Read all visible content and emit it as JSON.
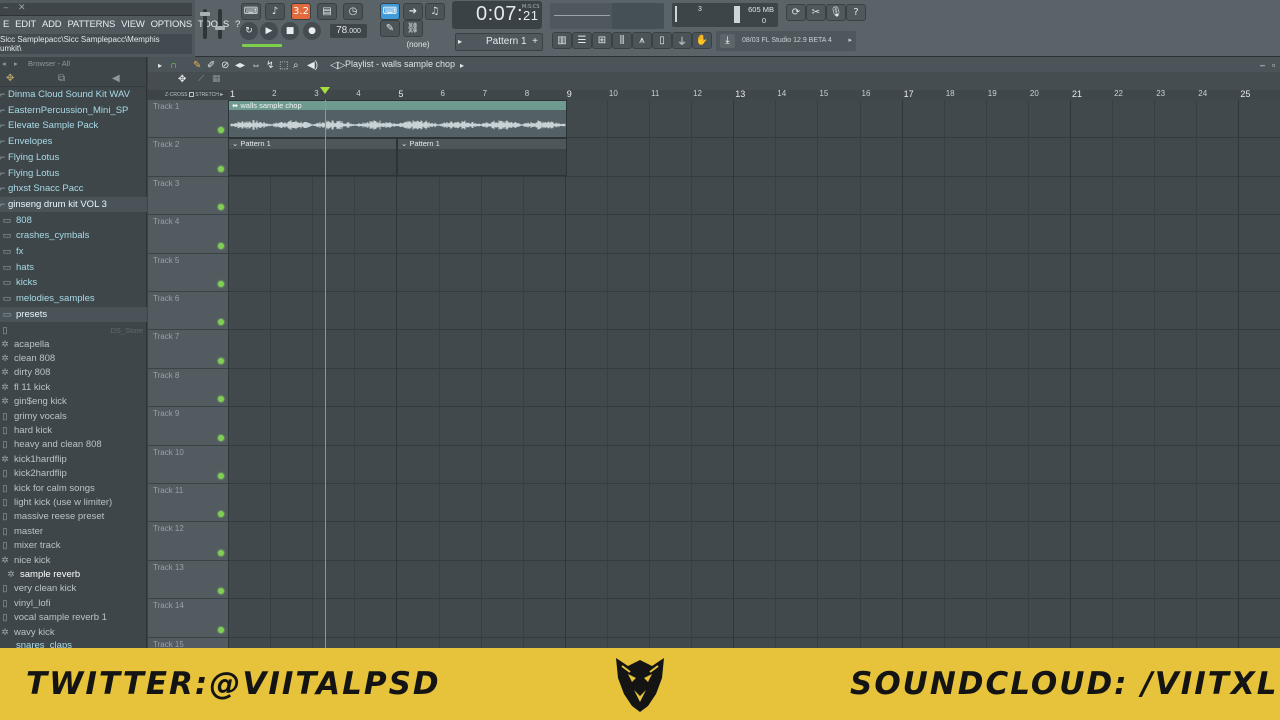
{
  "toolbar": {
    "menu": [
      "E",
      "EDIT",
      "ADD",
      "PATTERNS",
      "VIEW",
      "OPTIONS",
      "TOOLS",
      "?"
    ],
    "project_path": "Sicc Samplepacc\\Sicc Samplepacc\\Memphis\numkit\\",
    "tempo": "78",
    "tempo_decimal": ".000",
    "time": "0:07",
    "time_sub": "21",
    "time_unit": "M:S:CS",
    "pattern": "Pattern 1",
    "none_label": "(none)",
    "memory": "605 MB",
    "cpu_num": "3",
    "cpu_val": "0",
    "news": "08/03  FL Studio 12.9 BETA 4",
    "song_mode_label": "3.2"
  },
  "browser": {
    "header": "Browser - All",
    "items": [
      {
        "label": "Dinma Cloud Sound Kit WAV",
        "kind": "folder"
      },
      {
        "label": "EasternPercussion_Mini_SP",
        "kind": "folder"
      },
      {
        "label": "Elevate Sample Pack",
        "kind": "folder"
      },
      {
        "label": "Envelopes",
        "kind": "folder"
      },
      {
        "label": "Flying Lotus",
        "kind": "folder"
      },
      {
        "label": "Flying Lotus",
        "kind": "folder"
      },
      {
        "label": "ghxst Snacc Pacc",
        "kind": "folder"
      },
      {
        "label": "ginseng drum kit VOL 3",
        "kind": "open"
      },
      {
        "label": "808",
        "kind": "sub"
      },
      {
        "label": "crashes_cymbals",
        "kind": "sub"
      },
      {
        "label": "fx",
        "kind": "sub"
      },
      {
        "label": "hats",
        "kind": "sub"
      },
      {
        "label": "kicks",
        "kind": "sub"
      },
      {
        "label": "melodies_samples",
        "kind": "sub"
      },
      {
        "label": "presets",
        "kind": "sub-open"
      }
    ],
    "ds_store": "DS_Store",
    "presets": [
      "acapella",
      "clean 808",
      "dirty 808",
      "fl 11 kick",
      "gin$eng kick",
      "grimy vocals",
      "hard kick",
      "heavy and clean 808",
      "kick1hardflip",
      "kick2hardflip",
      "kick for calm songs",
      "light kick (use w limiter)",
      "massive reese preset",
      "master",
      "mixer track",
      "nice kick",
      "sample reverb",
      "very clean kick",
      "vinyl_lofi",
      "vocal sample reverb 1",
      "wavy kick"
    ],
    "bottom_item": "snares_claps"
  },
  "playlist": {
    "title": "Playlist - walls sample chop",
    "snap_label": "Z-CROSS",
    "stretch_label": "STRETCH",
    "ruler": [
      "1",
      "2",
      "3",
      "4",
      "5",
      "6",
      "7",
      "8",
      "9",
      "10",
      "11",
      "12",
      "13",
      "14",
      "15",
      "16",
      "17",
      "18",
      "19",
      "20",
      "21",
      "22",
      "23",
      "24",
      "25"
    ],
    "tracks": [
      "Track 1",
      "Track 2",
      "Track 3",
      "Track 4",
      "Track 5",
      "Track 6",
      "Track 7",
      "Track 8",
      "Track 9",
      "Track 10",
      "Track 11",
      "Track 12",
      "Track 13",
      "Track 14",
      "Track 15"
    ],
    "clips": {
      "audio_name": "walls sample chop",
      "pattern_a": "Pattern 1",
      "pattern_b": "Pattern 1"
    },
    "playhead_bar": 3.3
  },
  "banner": {
    "left": "TWITTER:@VIITALPSD",
    "right": "SOUNDCLOUD: /VIITXL",
    "bg_color": "#e6c33a"
  }
}
